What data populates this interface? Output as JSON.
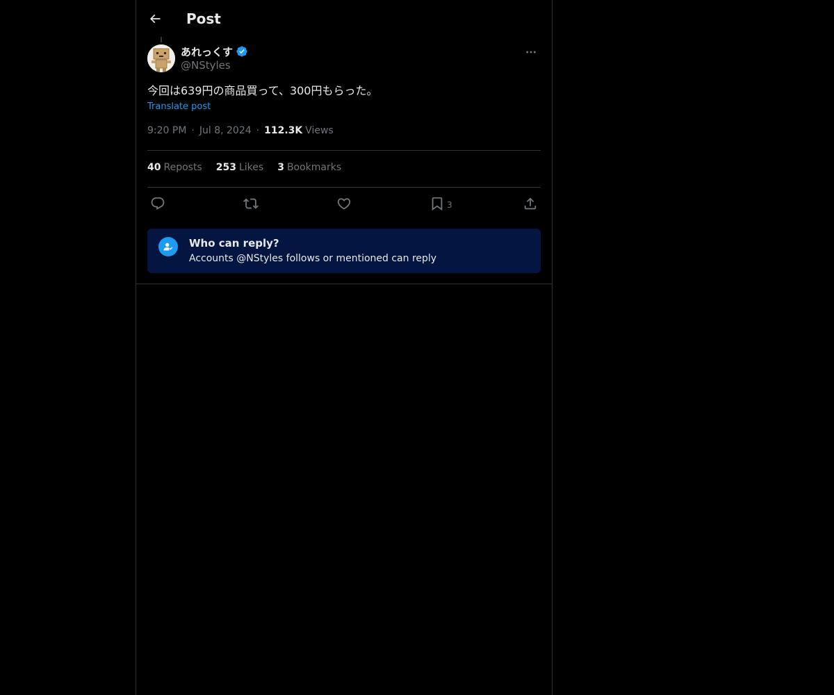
{
  "header": {
    "title": "Post",
    "back_icon": "arrow-left-icon"
  },
  "post": {
    "author": {
      "display_name": "あれっくす",
      "handle": "@NStyles",
      "verified": true,
      "verified_color": "#1d9bf0"
    },
    "text": "今回は639円の商品買って、300円もらった。",
    "translate_label": "Translate post",
    "time": "9:20 PM",
    "date": "Jul 8, 2024",
    "views_count": "112.3K",
    "views_label": "Views",
    "stats": {
      "reposts_count": "40",
      "reposts_label": "Reposts",
      "likes_count": "253",
      "likes_label": "Likes",
      "bookmarks_count": "3",
      "bookmarks_label": "Bookmarks"
    },
    "actions": {
      "bookmark_count": "3"
    }
  },
  "reply_restriction": {
    "title": "Who can reply?",
    "description": "Accounts @NStyles follows or mentioned can reply",
    "background": "#031540"
  },
  "colors": {
    "background": "#000000",
    "text_primary": "#e7e9ea",
    "text_secondary": "#71767b",
    "accent": "#1d9bf0",
    "border": "#2f3336"
  }
}
